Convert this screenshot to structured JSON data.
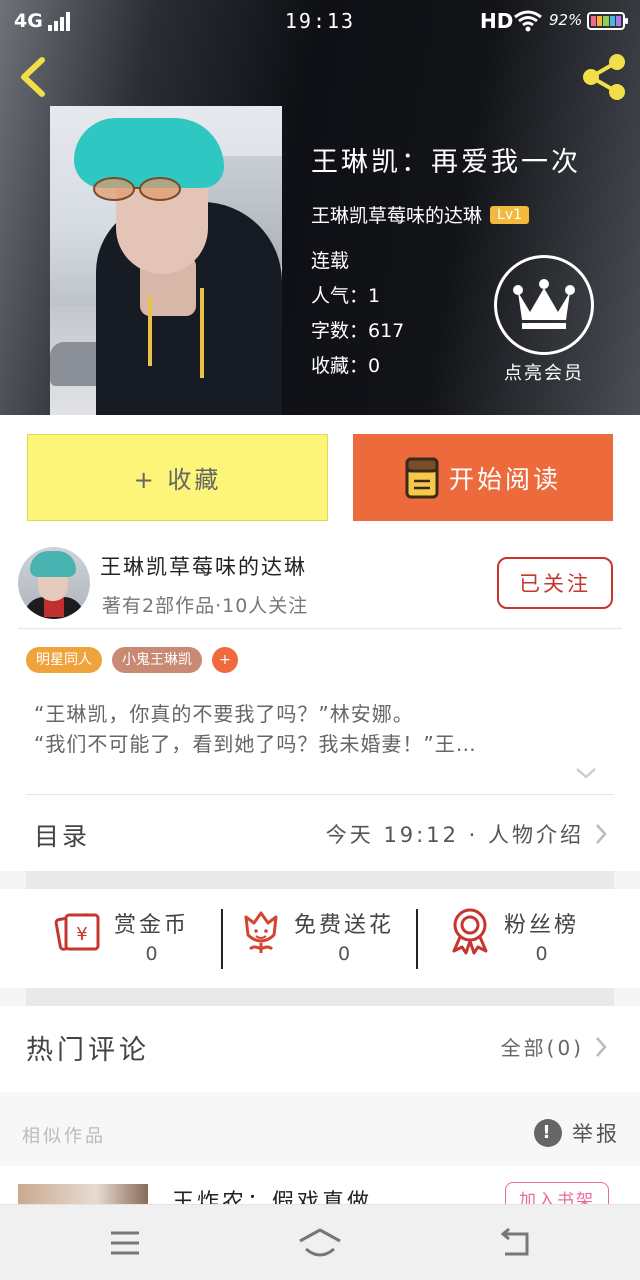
{
  "status_bar": {
    "network": "4G",
    "time": "19:13",
    "hd": "HD",
    "battery": "92%"
  },
  "book": {
    "title": "王琳凯：再爱我一次",
    "author": "王琳凯草莓味的达琳",
    "level": "Lv1",
    "status": "连载",
    "popularity": "人气：1",
    "word_count": "字数：617",
    "favorites": "收藏：0"
  },
  "vip": {
    "label": "点亮会员"
  },
  "actions": {
    "collect": "+ 收藏",
    "read": "开始阅读"
  },
  "author_card": {
    "name": "王琳凯草莓味的达琳",
    "subtitle": "著有2部作品·10人关注",
    "follow": "已关注"
  },
  "tags": [
    {
      "label": "明星同人",
      "color": "#f0a33c"
    },
    {
      "label": "小鬼王琳凯",
      "color": "#c98a73"
    },
    {
      "label": "+",
      "color": "#ef6a3c"
    }
  ],
  "synopsis": {
    "line1": "“王琳凯，你真的不要我了吗？”林安娜。",
    "line2": "“我们不可能了，看到她了吗？我未婚妻！”王…"
  },
  "toc": {
    "label": "目录",
    "right": "今天 19:12 · 人物介绍"
  },
  "stats": [
    {
      "label": "赏金币",
      "value": "0",
      "icon": "gold-coin-icon",
      "color": "#c6362f"
    },
    {
      "label": "免费送花",
      "value": "0",
      "icon": "flower-icon",
      "color": "#d2452e"
    },
    {
      "label": "粉丝榜",
      "value": "0",
      "icon": "rank-medal-icon",
      "color": "#c6362f"
    }
  ],
  "comments": {
    "label": "热门评论",
    "all": "全部(0)"
  },
  "similar": {
    "label": "相似作品",
    "report": "举报",
    "item_title": "王炸农：假戏真做",
    "add_shelf": "加入书架"
  }
}
